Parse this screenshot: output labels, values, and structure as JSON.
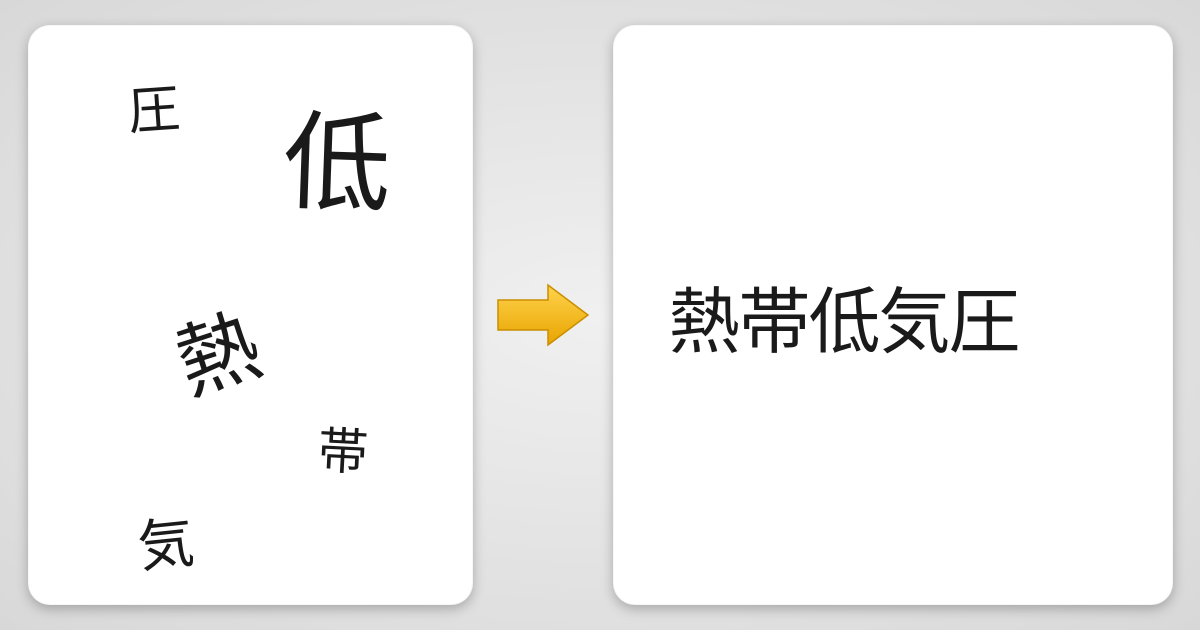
{
  "scattered": {
    "atsu": "圧",
    "tei": "低",
    "netsu": "熱",
    "tai": "帯",
    "ki": "気"
  },
  "arrow": {
    "name": "right-arrow-icon",
    "fill": "#f5b400",
    "stroke": "#d99a00"
  },
  "result": "熱帯低気圧"
}
